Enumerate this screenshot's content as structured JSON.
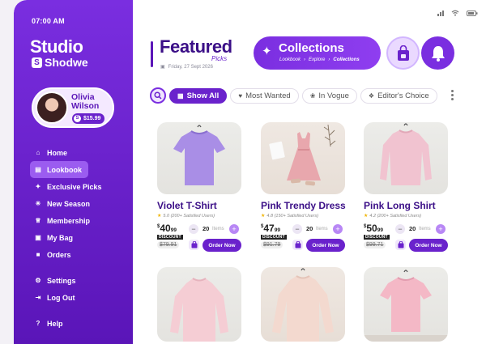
{
  "status_time": "07:00 AM",
  "brand": {
    "line1": "Studio",
    "line2": "Shodwe",
    "mark": "S"
  },
  "profile": {
    "name_first": "Olivia",
    "name_last": "Wilson",
    "balance": "$15.99"
  },
  "nav": [
    {
      "label": "Home",
      "icon": "home-icon"
    },
    {
      "label": "Lookbook",
      "icon": "book-icon",
      "active": true
    },
    {
      "label": "Exclusive Picks",
      "icon": "sparkle-icon"
    },
    {
      "label": "New Season",
      "icon": "star-icon"
    },
    {
      "label": "Membership",
      "icon": "crown-icon"
    },
    {
      "label": "My Bag",
      "icon": "bag-icon"
    },
    {
      "label": "Orders",
      "icon": "box-icon"
    }
  ],
  "nav_bottom": [
    {
      "label": "Settings",
      "icon": "gear-icon"
    },
    {
      "label": "Log Out",
      "icon": "logout-icon"
    },
    {
      "label": "Help",
      "icon": "help-icon"
    }
  ],
  "header": {
    "title": "Featured",
    "subtitle": "Picks",
    "date": "Friday, 27 Sept 2026"
  },
  "collections": {
    "title": "Collections",
    "crumbs": [
      "Lookbook",
      "Explore",
      "Collections"
    ]
  },
  "filters": [
    {
      "label": "Show All",
      "active": true
    },
    {
      "label": "Most Wanted"
    },
    {
      "label": "In Vogue"
    },
    {
      "label": "Editor's Choice"
    }
  ],
  "products": [
    {
      "name": "Violet T-Shirt",
      "rating": "5.0 (200+ Satisfied Users)",
      "price_currency": "$",
      "price_whole": "40",
      "price_cents": "99",
      "discount": "DISCOUNT",
      "old_price": "$79.91",
      "qty": "20",
      "qty_label": "Items",
      "order": "Order Now"
    },
    {
      "name": "Pink Trendy Dress",
      "rating": "4.8 (150+ Satisfied Users)",
      "price_currency": "$",
      "price_whole": "47",
      "price_cents": "99",
      "discount": "DISCOUNT",
      "old_price": "$91.79",
      "qty": "20",
      "qty_label": "Items",
      "order": "Order Now"
    },
    {
      "name": "Pink Long Shirt",
      "rating": "4.2 (200+ Satisfied Users)",
      "price_currency": "$",
      "price_whole": "50",
      "price_cents": "99",
      "discount": "DISCOUNT",
      "old_price": "$99.71",
      "qty": "20",
      "qty_label": "Items",
      "order": "Order Now"
    }
  ],
  "colors": {
    "primary": "#6a22cc",
    "sidebar": "#7a2ee0",
    "title": "#3b0f87"
  }
}
